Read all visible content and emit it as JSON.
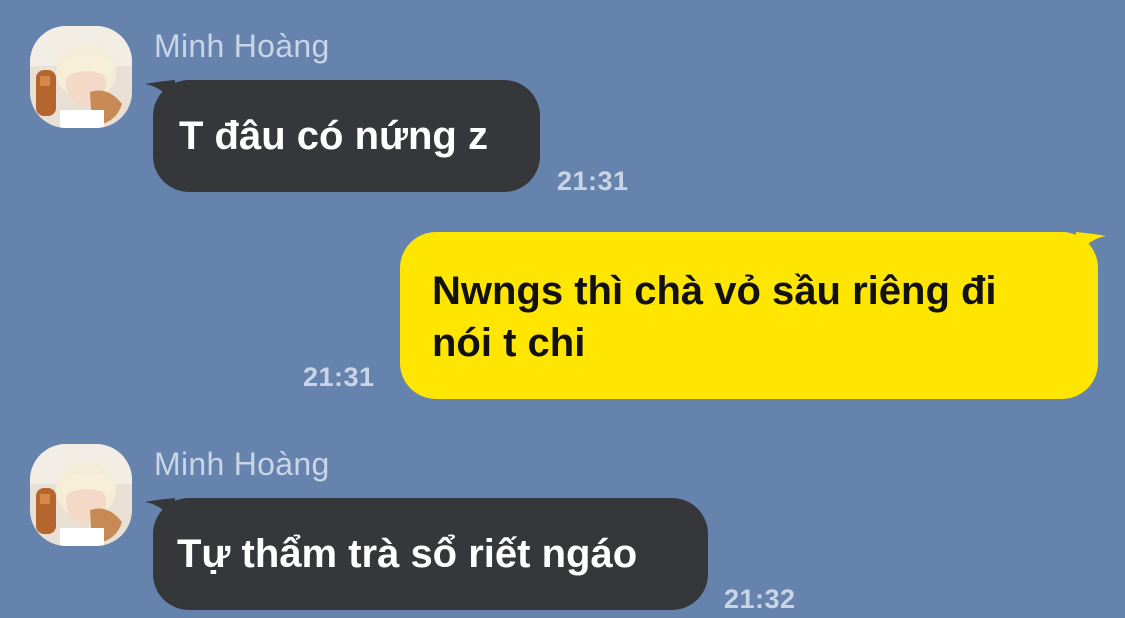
{
  "theme": {
    "background": "#6683ad",
    "incoming_bubble": "#36373b",
    "incoming_text": "#ffffff",
    "outgoing_bubble": "#ffe600",
    "outgoing_text": "#111111",
    "meta_text": "#c9d4e6"
  },
  "messages": [
    {
      "direction": "incoming",
      "sender": "Minh Hoàng",
      "avatar_icon": "contact-avatar-photo",
      "lines": [
        "T đâu có nứng z"
      ],
      "time": "21:31"
    },
    {
      "direction": "outgoing",
      "lines": [
        "Nwngs thì chà vỏ sầu riêng đi",
        "nói t chi"
      ],
      "time": "21:31"
    },
    {
      "direction": "incoming",
      "sender": "Minh Hoàng",
      "avatar_icon": "contact-avatar-photo",
      "lines": [
        "Tự thẩm trà sổ riết ngáo"
      ],
      "time": "21:32"
    }
  ]
}
